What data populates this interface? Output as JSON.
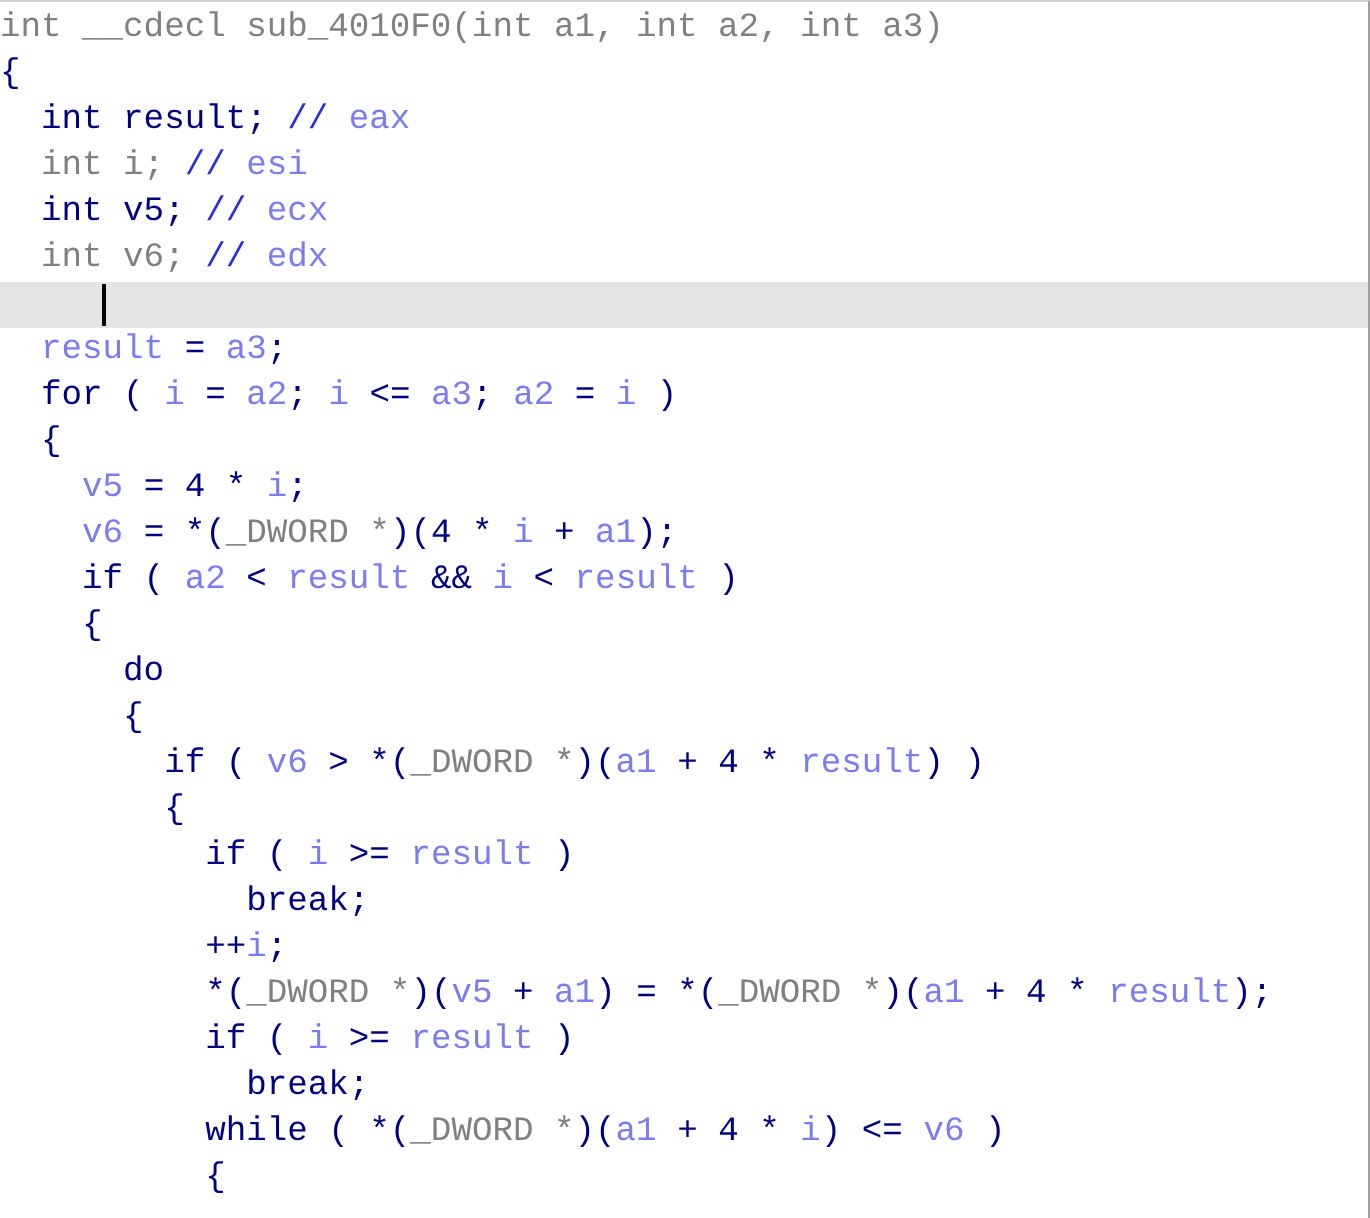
{
  "lines": [
    {
      "selected": false,
      "tokens": [
        {
          "kind": "gray",
          "text": "int __cdecl sub_4010F0(int a1, int a2, int a3)"
        }
      ]
    },
    {
      "selected": false,
      "tokens": [
        {
          "kind": "kw",
          "text": "{"
        }
      ]
    },
    {
      "selected": false,
      "tokens": [
        {
          "kind": "kw",
          "text": "  int result; "
        },
        {
          "kind": "cmark",
          "text": "//"
        },
        {
          "kind": "var",
          "text": " eax"
        }
      ]
    },
    {
      "selected": false,
      "tokens": [
        {
          "kind": "gray",
          "text": "  int i; "
        },
        {
          "kind": "cmark",
          "text": "//"
        },
        {
          "kind": "var",
          "text": " esi"
        }
      ]
    },
    {
      "selected": false,
      "tokens": [
        {
          "kind": "kw",
          "text": "  int v5; "
        },
        {
          "kind": "cmark",
          "text": "//"
        },
        {
          "kind": "var",
          "text": " ecx"
        }
      ]
    },
    {
      "selected": false,
      "tokens": [
        {
          "kind": "gray",
          "text": "  int v6; "
        },
        {
          "kind": "cmark",
          "text": "//"
        },
        {
          "kind": "var",
          "text": " edx"
        }
      ]
    },
    {
      "selected": true,
      "caret": true
    },
    {
      "selected": false,
      "tokens": [
        {
          "kind": "var",
          "text": "  result"
        },
        {
          "kind": "kw",
          "text": " = "
        },
        {
          "kind": "var",
          "text": "a3"
        },
        {
          "kind": "kw",
          "text": ";"
        }
      ]
    },
    {
      "selected": false,
      "tokens": [
        {
          "kind": "kw",
          "text": "  for ( "
        },
        {
          "kind": "var",
          "text": "i"
        },
        {
          "kind": "kw",
          "text": " = "
        },
        {
          "kind": "var",
          "text": "a2"
        },
        {
          "kind": "kw",
          "text": "; "
        },
        {
          "kind": "var",
          "text": "i"
        },
        {
          "kind": "kw",
          "text": " <= "
        },
        {
          "kind": "var",
          "text": "a3"
        },
        {
          "kind": "kw",
          "text": "; "
        },
        {
          "kind": "var",
          "text": "a2"
        },
        {
          "kind": "kw",
          "text": " = "
        },
        {
          "kind": "var",
          "text": "i"
        },
        {
          "kind": "kw",
          "text": " )"
        }
      ]
    },
    {
      "selected": false,
      "tokens": [
        {
          "kind": "kw",
          "text": "  {"
        }
      ]
    },
    {
      "selected": false,
      "tokens": [
        {
          "kind": "var",
          "text": "    v5"
        },
        {
          "kind": "kw",
          "text": " = 4 * "
        },
        {
          "kind": "var",
          "text": "i"
        },
        {
          "kind": "kw",
          "text": ";"
        }
      ]
    },
    {
      "selected": false,
      "tokens": [
        {
          "kind": "var",
          "text": "    v6"
        },
        {
          "kind": "kw",
          "text": " = *("
        },
        {
          "kind": "gray",
          "text": "_DWORD *"
        },
        {
          "kind": "kw",
          "text": ")(4 * "
        },
        {
          "kind": "var",
          "text": "i"
        },
        {
          "kind": "kw",
          "text": " + "
        },
        {
          "kind": "var",
          "text": "a1"
        },
        {
          "kind": "kw",
          "text": ");"
        }
      ]
    },
    {
      "selected": false,
      "tokens": [
        {
          "kind": "kw",
          "text": "    if ( "
        },
        {
          "kind": "var",
          "text": "a2"
        },
        {
          "kind": "kw",
          "text": " < "
        },
        {
          "kind": "var",
          "text": "result"
        },
        {
          "kind": "kw",
          "text": " && "
        },
        {
          "kind": "var",
          "text": "i"
        },
        {
          "kind": "kw",
          "text": " < "
        },
        {
          "kind": "var",
          "text": "result"
        },
        {
          "kind": "kw",
          "text": " )"
        }
      ]
    },
    {
      "selected": false,
      "tokens": [
        {
          "kind": "kw",
          "text": "    {"
        }
      ]
    },
    {
      "selected": false,
      "tokens": [
        {
          "kind": "kw",
          "text": "      do"
        }
      ]
    },
    {
      "selected": false,
      "tokens": [
        {
          "kind": "kw",
          "text": "      {"
        }
      ]
    },
    {
      "selected": false,
      "tokens": [
        {
          "kind": "kw",
          "text": "        if ( "
        },
        {
          "kind": "var",
          "text": "v6"
        },
        {
          "kind": "kw",
          "text": " > *("
        },
        {
          "kind": "gray",
          "text": "_DWORD *"
        },
        {
          "kind": "kw",
          "text": ")("
        },
        {
          "kind": "var",
          "text": "a1"
        },
        {
          "kind": "kw",
          "text": " + 4 * "
        },
        {
          "kind": "var",
          "text": "result"
        },
        {
          "kind": "kw",
          "text": ") )"
        }
      ]
    },
    {
      "selected": false,
      "tokens": [
        {
          "kind": "kw",
          "text": "        {"
        }
      ]
    },
    {
      "selected": false,
      "tokens": [
        {
          "kind": "kw",
          "text": "          if ( "
        },
        {
          "kind": "var",
          "text": "i"
        },
        {
          "kind": "kw",
          "text": " >= "
        },
        {
          "kind": "var",
          "text": "result"
        },
        {
          "kind": "kw",
          "text": " )"
        }
      ]
    },
    {
      "selected": false,
      "tokens": [
        {
          "kind": "kw",
          "text": "            break;"
        }
      ]
    },
    {
      "selected": false,
      "tokens": [
        {
          "kind": "kw",
          "text": "          ++"
        },
        {
          "kind": "var",
          "text": "i"
        },
        {
          "kind": "kw",
          "text": ";"
        }
      ]
    },
    {
      "selected": false,
      "tokens": [
        {
          "kind": "kw",
          "text": "          *("
        },
        {
          "kind": "gray",
          "text": "_DWORD *"
        },
        {
          "kind": "kw",
          "text": ")("
        },
        {
          "kind": "var",
          "text": "v5"
        },
        {
          "kind": "kw",
          "text": " + "
        },
        {
          "kind": "var",
          "text": "a1"
        },
        {
          "kind": "kw",
          "text": ") = *("
        },
        {
          "kind": "gray",
          "text": "_DWORD *"
        },
        {
          "kind": "kw",
          "text": ")("
        },
        {
          "kind": "var",
          "text": "a1"
        },
        {
          "kind": "kw",
          "text": " + 4 * "
        },
        {
          "kind": "var",
          "text": "result"
        },
        {
          "kind": "kw",
          "text": ");"
        }
      ]
    },
    {
      "selected": false,
      "tokens": [
        {
          "kind": "kw",
          "text": "          if ( "
        },
        {
          "kind": "var",
          "text": "i"
        },
        {
          "kind": "kw",
          "text": " >= "
        },
        {
          "kind": "var",
          "text": "result"
        },
        {
          "kind": "kw",
          "text": " )"
        }
      ]
    },
    {
      "selected": false,
      "tokens": [
        {
          "kind": "kw",
          "text": "            break;"
        }
      ]
    },
    {
      "selected": false,
      "tokens": [
        {
          "kind": "kw",
          "text": "          while ( *("
        },
        {
          "kind": "gray",
          "text": "_DWORD *"
        },
        {
          "kind": "kw",
          "text": ")("
        },
        {
          "kind": "var",
          "text": "a1"
        },
        {
          "kind": "kw",
          "text": " + 4 * "
        },
        {
          "kind": "var",
          "text": "i"
        },
        {
          "kind": "kw",
          "text": ") <= "
        },
        {
          "kind": "var",
          "text": "v6"
        },
        {
          "kind": "kw",
          "text": " )"
        }
      ]
    },
    {
      "selected": false,
      "tokens": [
        {
          "kind": "kw",
          "text": "          {"
        }
      ]
    }
  ]
}
